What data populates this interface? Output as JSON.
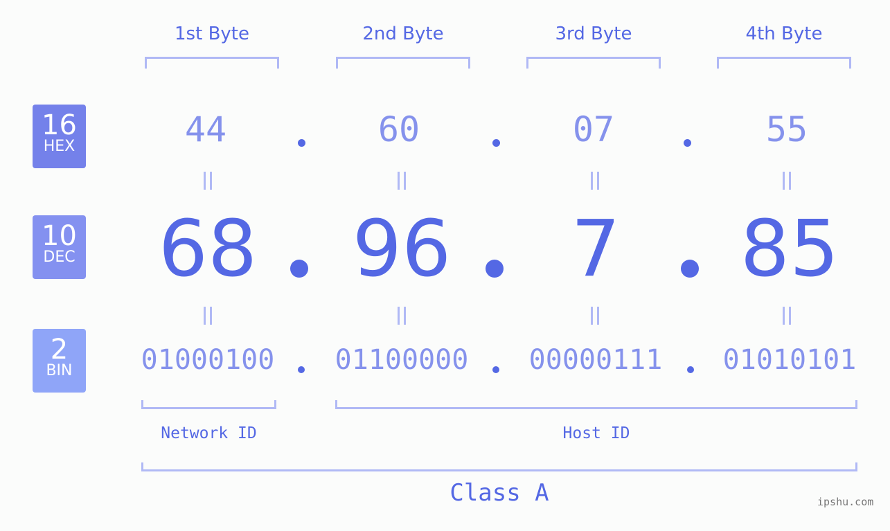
{
  "bytes": [
    {
      "label": "1st Byte",
      "hex": "44",
      "dec": "68",
      "bin": "01000100"
    },
    {
      "label": "2nd Byte",
      "hex": "60",
      "dec": "96",
      "bin": "01100000"
    },
    {
      "label": "3rd Byte",
      "hex": "07",
      "dec": "7",
      "bin": "00000111"
    },
    {
      "label": "4th Byte",
      "hex": "55",
      "dec": "85",
      "bin": "01010101"
    }
  ],
  "badges": {
    "hex": {
      "num": "16",
      "label": "HEX",
      "color": "#7481ea"
    },
    "dec": {
      "num": "10",
      "label": "DEC",
      "color": "#8491f0"
    },
    "bin": {
      "num": "2",
      "label": "BIN",
      "color": "#8fa5f8"
    }
  },
  "network_label": "Network ID",
  "host_label": "Host ID",
  "class_label": "Class A",
  "watermark": "ipshu.com"
}
